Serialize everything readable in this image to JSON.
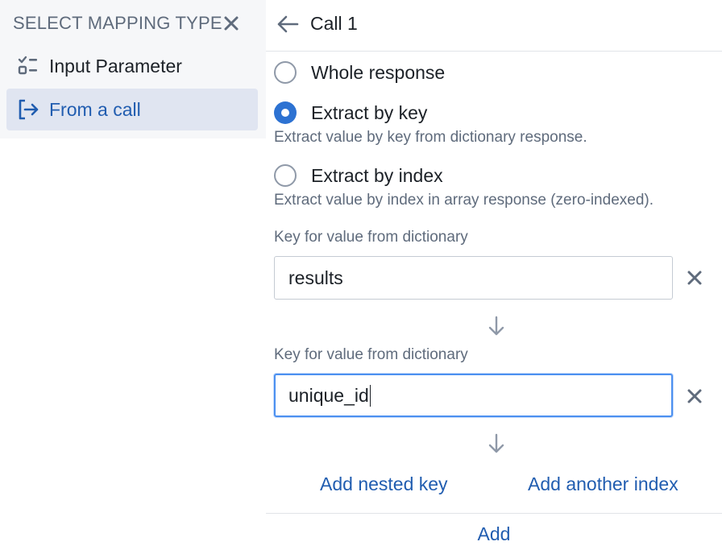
{
  "sidebar": {
    "title": "SELECT MAPPING TYPE",
    "close_icon": "close-icon",
    "items": [
      {
        "label": "Input Parameter",
        "icon": "input-parameter-icon",
        "selected": false
      },
      {
        "label": "From a call",
        "icon": "from-call-icon",
        "selected": true
      }
    ]
  },
  "main": {
    "back_icon": "arrow-left-icon",
    "title": "Call 1",
    "options": [
      {
        "label": "Whole response",
        "checked": false,
        "help": ""
      },
      {
        "label": "Extract by key",
        "checked": true,
        "help": "Extract value by key from dictionary response."
      },
      {
        "label": "Extract by index",
        "checked": false,
        "help": "Extract value by index in array response (zero-indexed)."
      }
    ],
    "keys": [
      {
        "label": "Key for value from dictionary",
        "value": "results",
        "focused": false
      },
      {
        "label": "Key for value from dictionary",
        "value": "unique_id",
        "focused": true
      }
    ],
    "add_nested_key": "Add nested key",
    "add_another_index": "Add another index",
    "add": "Add"
  },
  "colors": {
    "accent": "#2d72d2",
    "link": "#215db0",
    "muted_text": "#5f6b7c",
    "selected_bg": "#e0e5f1",
    "panel_bg": "#f6f7f9"
  }
}
